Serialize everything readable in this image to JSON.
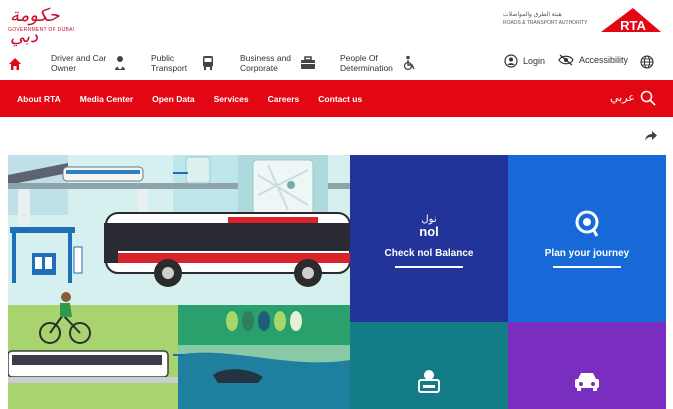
{
  "header": {
    "gov_logo_ar": "حكومة دبي",
    "gov_logo_en": "GOVERNMENT OF DUBAI",
    "rta_logo_ar": "هيئة الطرق والمواصلات",
    "rta_logo_en": "ROADS & TRANSPORT AUTHORITY",
    "rta_logo_text": "RTA"
  },
  "nav": {
    "items": [
      {
        "label": "Driver and Car Owner",
        "icon": "driver-icon"
      },
      {
        "label": "Public Transport",
        "icon": "bus-icon"
      },
      {
        "label": "Business and Corporate",
        "icon": "briefcase-icon"
      },
      {
        "label": "People Of Determination",
        "icon": "wheelchair-icon"
      }
    ],
    "login_label": "Login",
    "accessibility_label": "Accessibility"
  },
  "menu": {
    "items": [
      "About RTA",
      "Media Center",
      "Open Data",
      "Services",
      "Careers",
      "Contact us"
    ],
    "lang_label": "عربي"
  },
  "tiles": {
    "nol_logo": "نول nol",
    "nol_label": "Check nol Balance",
    "journey_label": "Plan your journey"
  },
  "colors": {
    "brand_red": "#e30613",
    "tile_navy": "#22349a",
    "tile_blue": "#1769d8",
    "tile_teal": "#137c86",
    "tile_purple": "#7a2ec0"
  }
}
